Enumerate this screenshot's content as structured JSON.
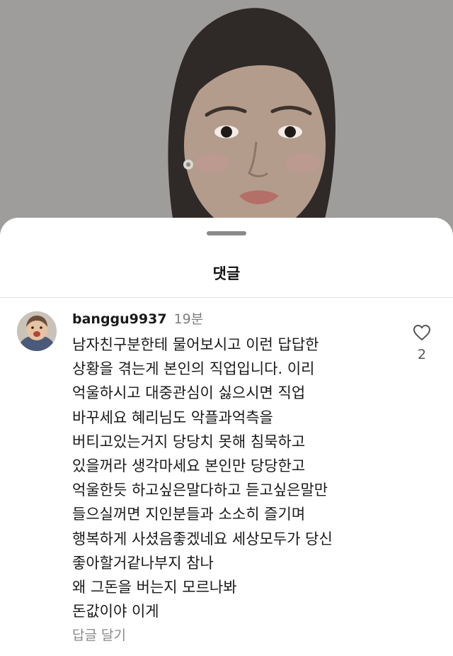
{
  "background_photo": {
    "description_icon": "portrait-photo"
  },
  "sheet": {
    "title": "댓글"
  },
  "comment": {
    "username": "banggu9937",
    "timestamp": "19분",
    "lines": [
      "남자친구분한테 물어보시고 이런 답답한",
      "상황을 겪는게 본인의 직업입니다. 이리",
      "억울하시고 대중관심이 싫으시면 직업",
      "바꾸세요 혜리님도 악플과억측을",
      "버티고있는거지 당당치 못해 침묵하고",
      "있을꺼라 생각마세요 본인만 당당한고",
      "억울한듯 하고싶은말다하고 듣고싶은말만",
      "들으실꺼면 지인분들과 소소히 즐기며",
      "행복하게 사셨음좋겠네요 세상모두가 당신",
      "좋아할거같나부지 참나",
      "왜 그돈을 버는지 모르나봐",
      "돈값이야 이게"
    ],
    "reply_label": "답글 달기",
    "like_count": "2",
    "like_icon": "heart-outline-icon"
  },
  "colors": {
    "overlay": "#9d9b99",
    "text": "#1a1a1a",
    "muted": "#7d7d7d"
  }
}
